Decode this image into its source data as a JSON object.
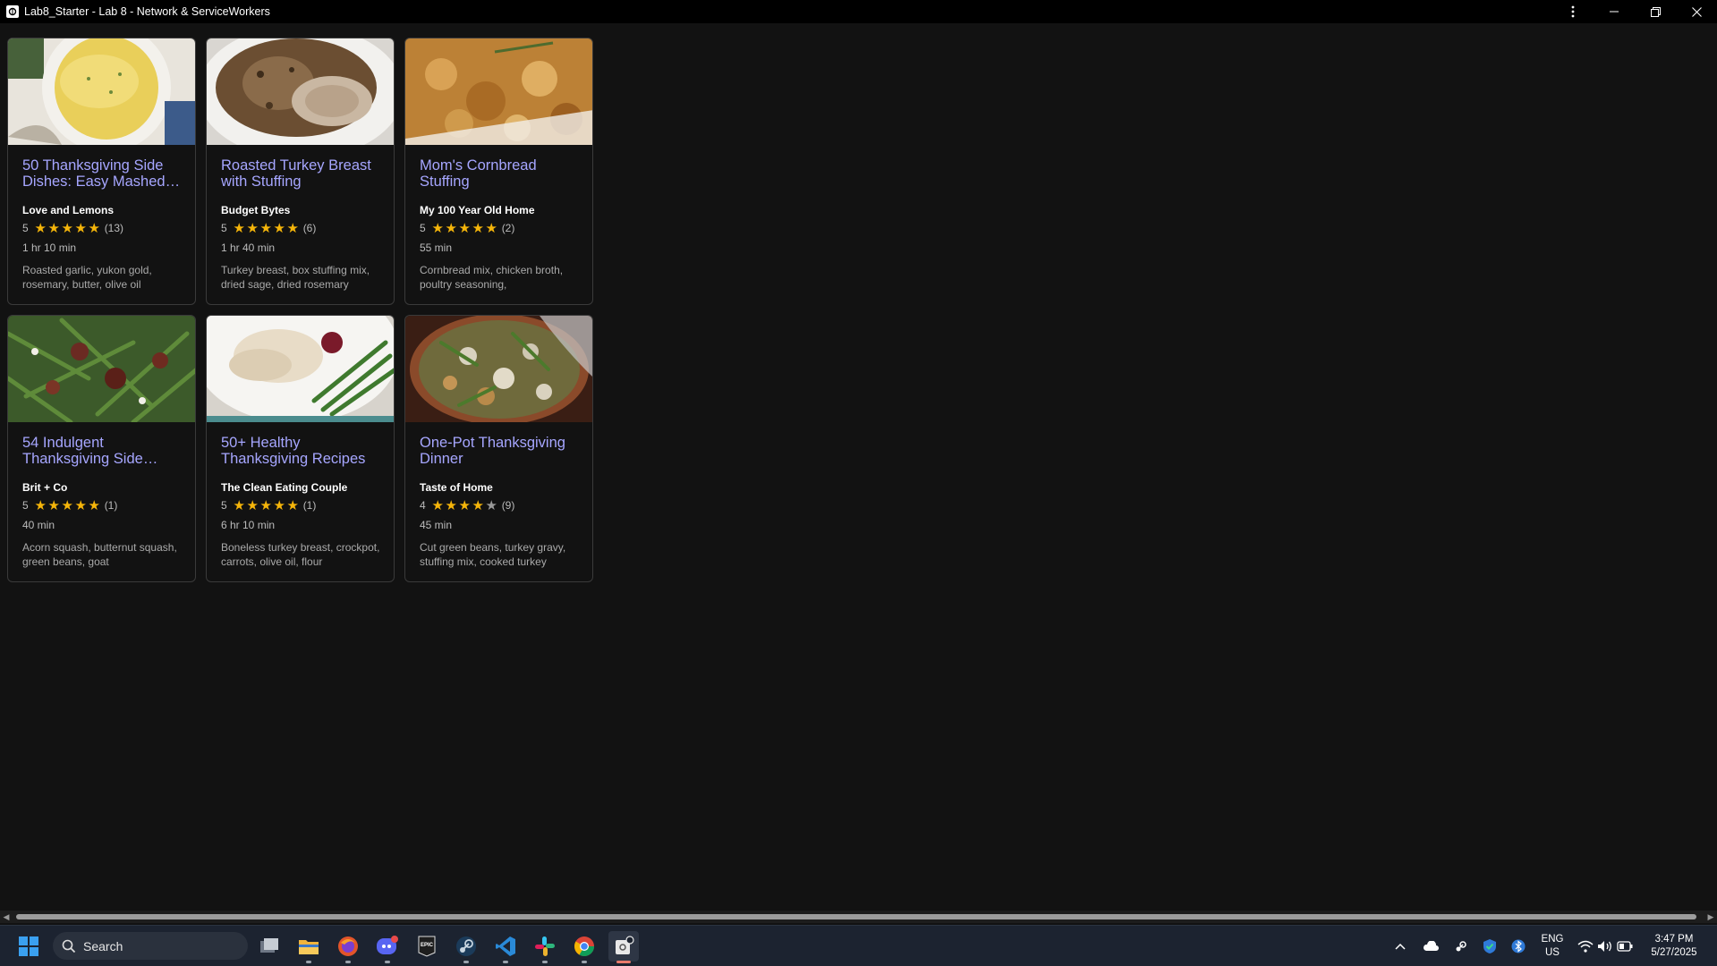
{
  "window": {
    "title": "Lab8_Starter - Lab 8 - Network & ServiceWorkers",
    "controls": [
      "more-icon",
      "minimize-icon",
      "restore-icon",
      "close-icon"
    ]
  },
  "recipes": [
    {
      "title": "50 Thanksgiving Side Dishes: Easy Mashed…",
      "org": "Love and Lemons",
      "rating": "5",
      "stars": 5,
      "reviews": "(13)",
      "time": "1 hr 10 min",
      "ingredients": "Roasted garlic, yukon gold, rosemary, butter, olive oil",
      "image": "mashed-potatoes"
    },
    {
      "title": "Roasted Turkey Breast with Stuffing",
      "org": "Budget Bytes",
      "rating": "5",
      "stars": 5,
      "reviews": "(6)",
      "time": "1 hr 40 min",
      "ingredients": "Turkey breast, box stuffing mix, dried sage, dried rosemary",
      "image": "turkey-stuffing"
    },
    {
      "title": "Mom's Cornbread Stuffing",
      "org": "My 100 Year Old Home",
      "rating": "5",
      "stars": 5,
      "reviews": "(2)",
      "time": "55 min",
      "ingredients": "Cornbread mix, chicken broth, poultry seasoning,",
      "image": "cornbread-stuffing"
    },
    {
      "title": "54 Indulgent Thanksgiving Side…",
      "org": "Brit + Co",
      "rating": "5",
      "stars": 5,
      "reviews": "(1)",
      "time": "40 min",
      "ingredients": "Acorn squash, butternut squash, green beans, goat",
      "image": "green-beans"
    },
    {
      "title": "50+ Healthy Thanksgiving Recipes",
      "org": "The Clean Eating Couple",
      "rating": "5",
      "stars": 5,
      "reviews": "(1)",
      "time": "6 hr 10 min",
      "ingredients": "Boneless turkey breast, crockpot, carrots, olive oil, flour",
      "image": "turkey-plate"
    },
    {
      "title": "One-Pot Thanksgiving Dinner",
      "org": "Taste of Home",
      "rating": "4",
      "stars": 4,
      "reviews": "(9)",
      "time": "45 min",
      "ingredients": "Cut green beans, turkey gravy, stuffing mix, cooked turkey",
      "image": "one-pot-dinner"
    }
  ],
  "taskbar": {
    "search_placeholder": "Search",
    "apps": [
      "start-icon",
      "search-icon",
      "task-view-icon",
      "file-explorer-icon",
      "firefox-icon",
      "discord-icon",
      "epic-games-icon",
      "steam-icon",
      "vscode-icon",
      "slack-icon",
      "chrome-icon",
      "pwa-app-icon"
    ],
    "tray": {
      "lang_line1": "ENG",
      "lang_line2": "US",
      "time": "3:47 PM",
      "date": "5/27/2025"
    }
  },
  "colors": {
    "background": "#121212",
    "title_link": "#a6a6ff",
    "star": "#f5b50a",
    "taskbar": "#1c2330"
  }
}
